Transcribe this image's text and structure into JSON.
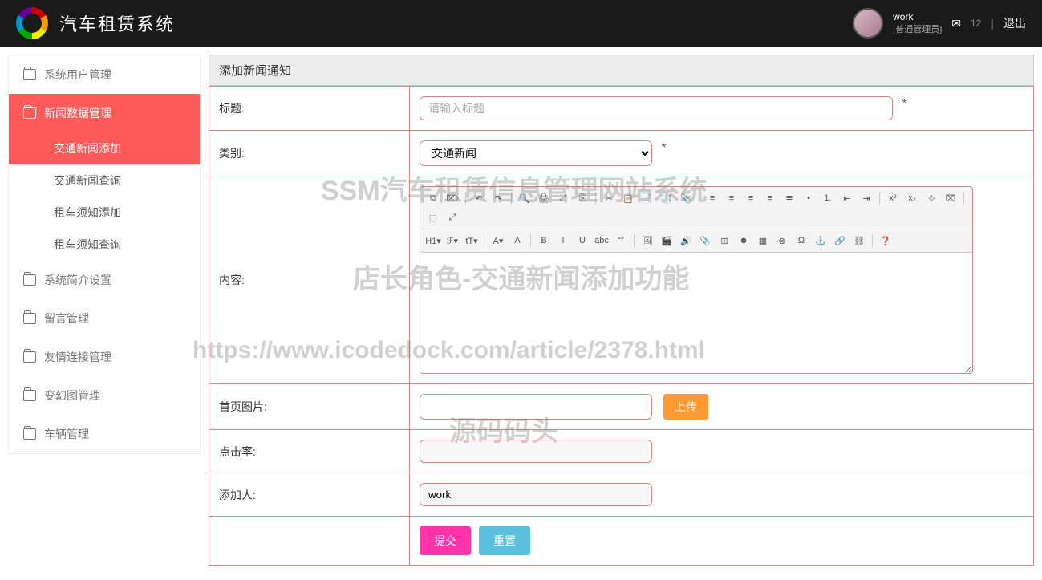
{
  "header": {
    "app_title": "汽车租赁系统",
    "username": "work",
    "role": "[普通管理员]",
    "mail_badge": "12",
    "logout": "退出"
  },
  "sidebar": {
    "items": [
      {
        "label": "系统用户管理",
        "active": false
      },
      {
        "label": "新闻数据管理",
        "active": true,
        "subs": [
          {
            "label": "交通新闻添加",
            "active": true
          },
          {
            "label": "交通新闻查询",
            "active": false
          },
          {
            "label": "租车须知添加",
            "active": false
          },
          {
            "label": "租车须知查询",
            "active": false
          }
        ]
      },
      {
        "label": "系统简介设置",
        "active": false
      },
      {
        "label": "留言管理",
        "active": false
      },
      {
        "label": "友情连接管理",
        "active": false
      },
      {
        "label": "变幻图管理",
        "active": false
      },
      {
        "label": "车辆管理",
        "active": false
      }
    ]
  },
  "form": {
    "panel_title": "添加新闻通知",
    "labels": {
      "title": "标题:",
      "category": "类别:",
      "content": "内容:",
      "cover": "首页图片:",
      "hits": "点击率:",
      "author": "添加人:"
    },
    "title_placeholder": "请输入标题",
    "category_selected": "交通新闻",
    "upload_btn": "上传",
    "author_value": "work",
    "hits_value": "",
    "submit": "提交",
    "reset": "重置",
    "required_mark": "*"
  },
  "editor_toolbar_row1": [
    "⧉",
    "⌦",
    "|",
    "↶",
    "↷",
    "|",
    "🔍",
    "🖨",
    "⤢",
    "⎘",
    "|",
    "✂",
    "📋",
    "📄",
    "📑",
    "📎",
    "|",
    "≡",
    "≡",
    "≡",
    "≡",
    "≣",
    "•",
    "1.",
    "⇤",
    "⇥",
    "|",
    "x²",
    "x₂",
    "⎀",
    "⌧",
    "|",
    "⬚",
    "⤢"
  ],
  "editor_toolbar_row2": [
    "H1▾",
    "ℱ▾",
    "tT▾",
    "|",
    "A▾",
    "A",
    "|",
    "B",
    "I",
    "U",
    "abc",
    "“”",
    "|",
    "🖼",
    "🎬",
    "🔊",
    "📎",
    "⊞",
    "☻",
    "▦",
    "⊗",
    "Ω",
    "⚓",
    "🔗",
    "⛓",
    "|",
    "❓"
  ],
  "watermarks": {
    "w1": "SSM汽车租赁信息管理网站系统",
    "w2": "店长角色-交通新闻添加功能",
    "w3": "https://www.icodedock.com/article/2378.html",
    "w4": "源码码头"
  }
}
